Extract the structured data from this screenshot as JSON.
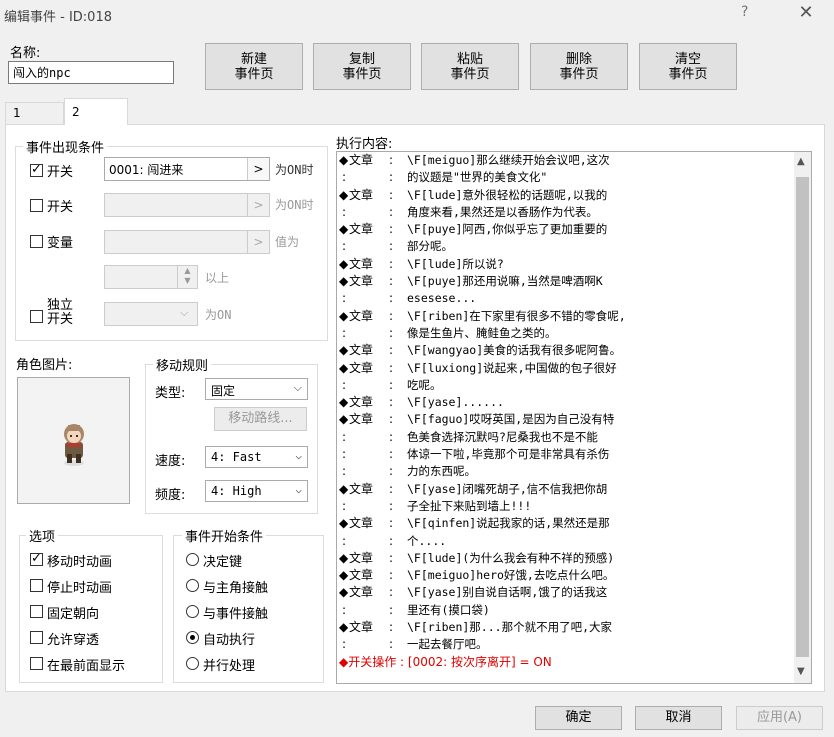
{
  "window": {
    "title": "编辑事件 - ID:018",
    "help": "?",
    "close": "✕"
  },
  "name": {
    "label": "名称:",
    "value": "闯入的npc"
  },
  "page_buttons": [
    {
      "line1": "新建",
      "line2": "事件页"
    },
    {
      "line1": "复制",
      "line2": "事件页"
    },
    {
      "line1": "粘贴",
      "line2": "事件页"
    },
    {
      "line1": "删除",
      "line2": "事件页"
    },
    {
      "line1": "清空",
      "line2": "事件页"
    }
  ],
  "tabs": [
    "1",
    "2"
  ],
  "conditions": {
    "legend": "事件出现条件",
    "switch1": {
      "checked": true,
      "label": "开关",
      "value": "0001: 闯进来",
      "suffix": "为ON时"
    },
    "switch2": {
      "checked": false,
      "label": "开关",
      "value": "",
      "suffix": "为ON时"
    },
    "variable": {
      "checked": false,
      "label": "变量",
      "value": "",
      "suffix": "值为",
      "below": "以上"
    },
    "self_switch": {
      "checked": false,
      "label_line1": "独立",
      "label_line2": "开关",
      "suffix": "为ON"
    }
  },
  "graphic": {
    "label": "角色图片:"
  },
  "movement": {
    "legend": "移动规则",
    "type_label": "类型:",
    "type_value": "固定",
    "route_button": "移动路线...",
    "speed_label": "速度:",
    "speed_value": "4: Fast",
    "freq_label": "频度:",
    "freq_value": "4: High"
  },
  "options": {
    "legend": "选项",
    "items": [
      {
        "label": "移动时动画",
        "checked": true
      },
      {
        "label": "停止时动画",
        "checked": false
      },
      {
        "label": "固定朝向",
        "checked": false
      },
      {
        "label": "允许穿透",
        "checked": false
      },
      {
        "label": "在最前面显示",
        "checked": false
      }
    ]
  },
  "trigger": {
    "legend": "事件开始条件",
    "items": [
      {
        "label": "决定键",
        "checked": false
      },
      {
        "label": "与主角接触",
        "checked": false
      },
      {
        "label": "与事件接触",
        "checked": false
      },
      {
        "label": "自动执行",
        "checked": true
      },
      {
        "label": "并行处理",
        "checked": false
      }
    ]
  },
  "contents": {
    "label": "执行内容:",
    "lines": [
      {
        "b": "◆",
        "k": "文章",
        "t": "\\F[meiguo]那么继续开始会议吧,这次"
      },
      {
        "b": "",
        "k": "",
        "t": "的议题是\"世界的美食文化\""
      },
      {
        "b": "◆",
        "k": "文章",
        "t": "\\F[lude]意外很轻松的话题呢,以我的"
      },
      {
        "b": "",
        "k": "",
        "t": "角度来看,果然还是以香肠作为代表。"
      },
      {
        "b": "◆",
        "k": "文章",
        "t": "\\F[puye]阿西,你似乎忘了更加重要的"
      },
      {
        "b": "",
        "k": "",
        "t": "部分呢。"
      },
      {
        "b": "◆",
        "k": "文章",
        "t": "\\F[lude]所以说?"
      },
      {
        "b": "◆",
        "k": "文章",
        "t": "\\F[puye]那还用说嘛,当然是啤酒啊K"
      },
      {
        "b": "",
        "k": "",
        "t": "esesese..."
      },
      {
        "b": "◆",
        "k": "文章",
        "t": "\\F[riben]在下家里有很多不错的零食呢,"
      },
      {
        "b": "",
        "k": "",
        "t": "像是生鱼片、腌鲑鱼之类的。"
      },
      {
        "b": "◆",
        "k": "文章",
        "t": "\\F[wangyao]美食的话我有很多呢阿鲁。"
      },
      {
        "b": "◆",
        "k": "文章",
        "t": "\\F[luxiong]说起来,中国做的包子很好"
      },
      {
        "b": "",
        "k": "",
        "t": "吃呢。"
      },
      {
        "b": "◆",
        "k": "文章",
        "t": "\\F[yase]......"
      },
      {
        "b": "◆",
        "k": "文章",
        "t": "\\F[faguo]哎呀英国,是因为自己没有特"
      },
      {
        "b": "",
        "k": "",
        "t": "色美食选择沉默吗?尼桑我也不是不能"
      },
      {
        "b": "",
        "k": "",
        "t": "体谅一下啦,毕竟那个可是非常具有杀伤"
      },
      {
        "b": "",
        "k": "",
        "t": "力的东西呢。"
      },
      {
        "b": "◆",
        "k": "文章",
        "t": "\\F[yase]闭嘴死胡子,信不信我把你胡"
      },
      {
        "b": "",
        "k": "",
        "t": "子全扯下来贴到墙上!!!"
      },
      {
        "b": "◆",
        "k": "文章",
        "t": "\\F[qinfen]说起我家的话,果然还是那"
      },
      {
        "b": "",
        "k": "",
        "t": "个...."
      },
      {
        "b": "◆",
        "k": "文章",
        "t": "\\F[lude](为什么我会有种不祥的预感)"
      },
      {
        "b": "◆",
        "k": "文章",
        "t": "\\F[meiguo]hero好饿,去吃点什么吧。"
      },
      {
        "b": "◆",
        "k": "文章",
        "t": "\\F[yase]别自说自话啊,饿了的话我这"
      },
      {
        "b": "",
        "k": "",
        "t": "里还有(摸口袋)"
      },
      {
        "b": "◆",
        "k": "文章",
        "t": "\\F[riben]那...那个就不用了吧,大家"
      },
      {
        "b": "",
        "k": "",
        "t": "一起去餐厅吧。"
      }
    ],
    "last_line": "◆开关操作 : [0002: 按次序离开] = ON"
  },
  "footer": {
    "ok": "确定",
    "cancel": "取消",
    "apply": "应用(A)"
  },
  "colors": {
    "red_text": "#e00000",
    "background": "#f0f0f0"
  }
}
